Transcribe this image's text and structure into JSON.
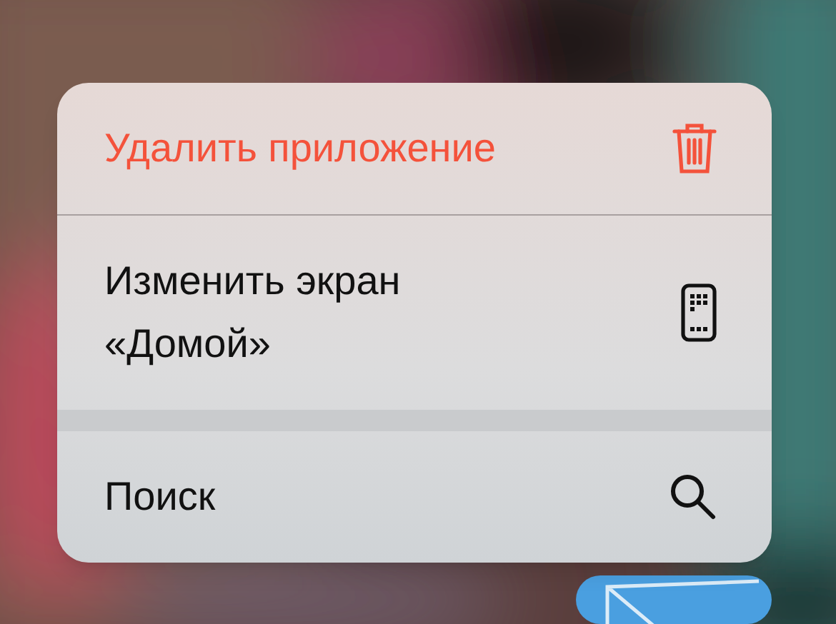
{
  "menu": {
    "sections": [
      [
        {
          "label": "Удалить приложение",
          "kind": "destructive"
        },
        {
          "label": "Изменить экран «Домой»",
          "kind": "default"
        }
      ],
      [
        {
          "label": "Поиск",
          "kind": "default"
        }
      ]
    ]
  }
}
